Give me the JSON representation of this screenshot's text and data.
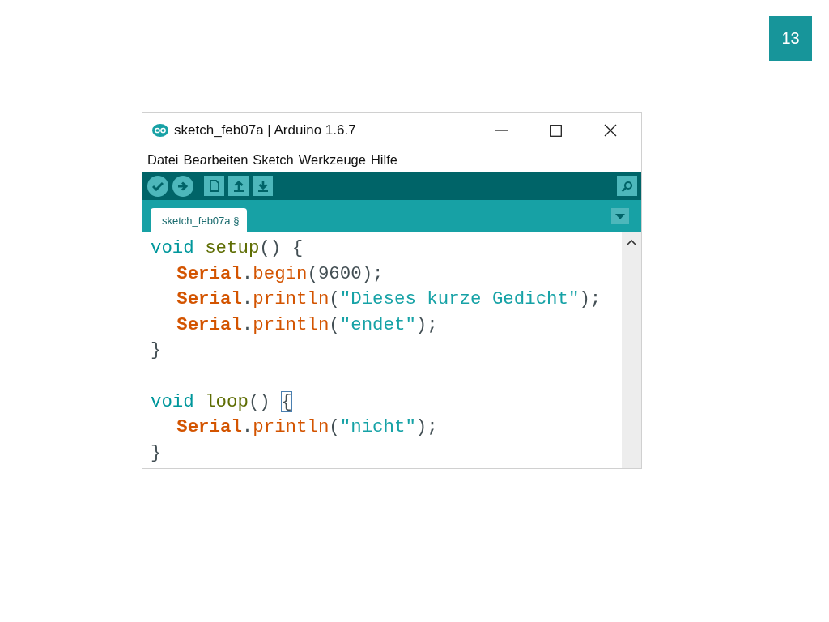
{
  "slide": {
    "page_number": "13"
  },
  "window": {
    "title": "sketch_feb07a | Arduino 1.6.7"
  },
  "menu": [
    "Datei",
    "Bearbeiten",
    "Sketch",
    "Werkzeuge",
    "Hilfe"
  ],
  "tabs": [
    {
      "label": "sketch_feb07a §",
      "selected": true
    }
  ],
  "code": [
    {
      "indent": false,
      "tokens": [
        {
          "text": "void",
          "kind": "keyword"
        },
        {
          "text": "setup",
          "kind": "function",
          "gap_before": true
        },
        {
          "text": "() {",
          "kind": "plain"
        }
      ]
    },
    {
      "indent": true,
      "tokens": [
        {
          "text": "Serial",
          "kind": "class"
        },
        {
          "text": ".",
          "kind": "plain"
        },
        {
          "text": "begin",
          "kind": "method"
        },
        {
          "text": "(9600);",
          "kind": "plain"
        }
      ]
    },
    {
      "indent": true,
      "tokens": [
        {
          "text": "Serial",
          "kind": "class"
        },
        {
          "text": ".",
          "kind": "plain"
        },
        {
          "text": "println",
          "kind": "method"
        },
        {
          "text": "(",
          "kind": "plain"
        },
        {
          "text": "\"Dieses kurze Gedicht\"",
          "kind": "string"
        },
        {
          "text": ");",
          "kind": "plain"
        }
      ]
    },
    {
      "indent": true,
      "tokens": [
        {
          "text": "Serial",
          "kind": "class"
        },
        {
          "text": ".",
          "kind": "plain"
        },
        {
          "text": "println",
          "kind": "method"
        },
        {
          "text": "(",
          "kind": "plain"
        },
        {
          "text": "\"endet\"",
          "kind": "string"
        },
        {
          "text": ");",
          "kind": "plain"
        }
      ]
    },
    {
      "indent": false,
      "tokens": [
        {
          "text": "}",
          "kind": "plain"
        }
      ]
    },
    {
      "kind": "blank"
    },
    {
      "indent": false,
      "tokens": [
        {
          "text": "void",
          "kind": "keyword"
        },
        {
          "text": "loop",
          "kind": "function",
          "gap_before": true
        },
        {
          "text": "()",
          "kind": "plain"
        },
        {
          "text": "{",
          "kind": "bracket-match",
          "gap_before": true
        }
      ]
    },
    {
      "indent": true,
      "tokens": [
        {
          "text": "Serial",
          "kind": "class"
        },
        {
          "text": ".",
          "kind": "plain"
        },
        {
          "text": "println",
          "kind": "method"
        },
        {
          "text": "(",
          "kind": "plain"
        },
        {
          "text": "\"nicht\"",
          "kind": "string"
        },
        {
          "text": ");",
          "kind": "plain"
        }
      ]
    },
    {
      "indent": false,
      "tokens": [
        {
          "text": "}",
          "kind": "plain"
        }
      ]
    }
  ]
}
